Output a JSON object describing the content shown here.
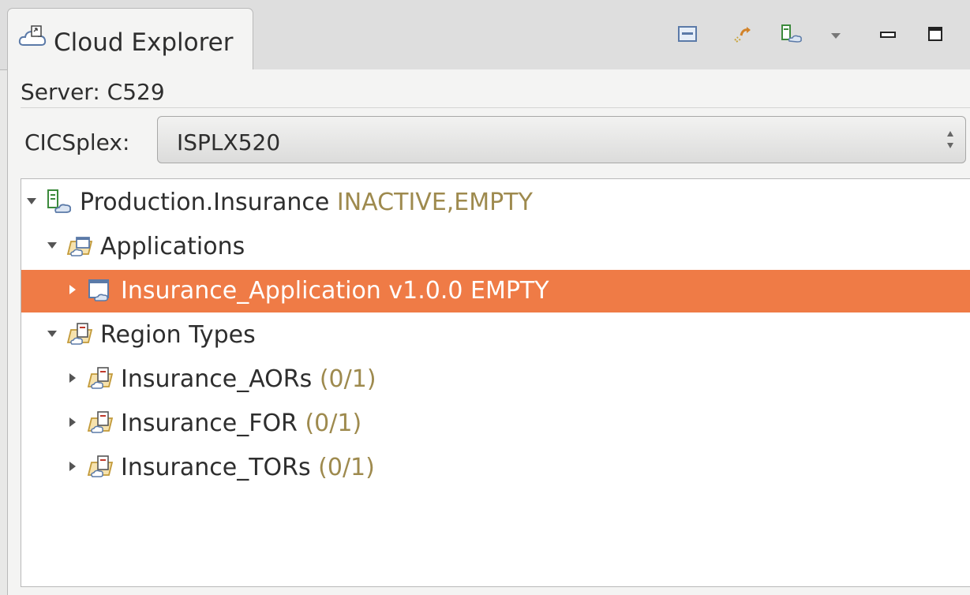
{
  "tab": {
    "title": "Cloud Explorer",
    "icon": "cloud-explorer-icon"
  },
  "toolbar": {
    "buttons": [
      {
        "name": "collapse-all-icon"
      },
      {
        "name": "refresh-icon"
      },
      {
        "name": "region-filter-icon"
      },
      {
        "name": "view-menu-chevron-icon"
      },
      {
        "name": "minimize-icon"
      },
      {
        "name": "maximize-icon"
      }
    ]
  },
  "server": {
    "label": "Server: C529"
  },
  "cicsplex": {
    "label": "CICSplex:",
    "value": "ISPLX520"
  },
  "tree": {
    "root": {
      "label": "Production.Insurance",
      "status": "INACTIVE,EMPTY",
      "expanded": true
    },
    "applications": {
      "label": "Applications",
      "expanded": true
    },
    "application_item": {
      "label": "Insurance_Application",
      "status": "v1.0.0 EMPTY",
      "selected": true
    },
    "region_types": {
      "label": "Region Types",
      "expanded": true
    },
    "region_items": [
      {
        "label": "Insurance_AORs",
        "status": "(0/1)"
      },
      {
        "label": "Insurance_FOR",
        "status": "(0/1)"
      },
      {
        "label": "Insurance_TORs",
        "status": "(0/1)"
      }
    ]
  },
  "colors": {
    "selection": "#ef7b46",
    "status_text": "#9e8a4e",
    "background": "#f4f4f3"
  }
}
